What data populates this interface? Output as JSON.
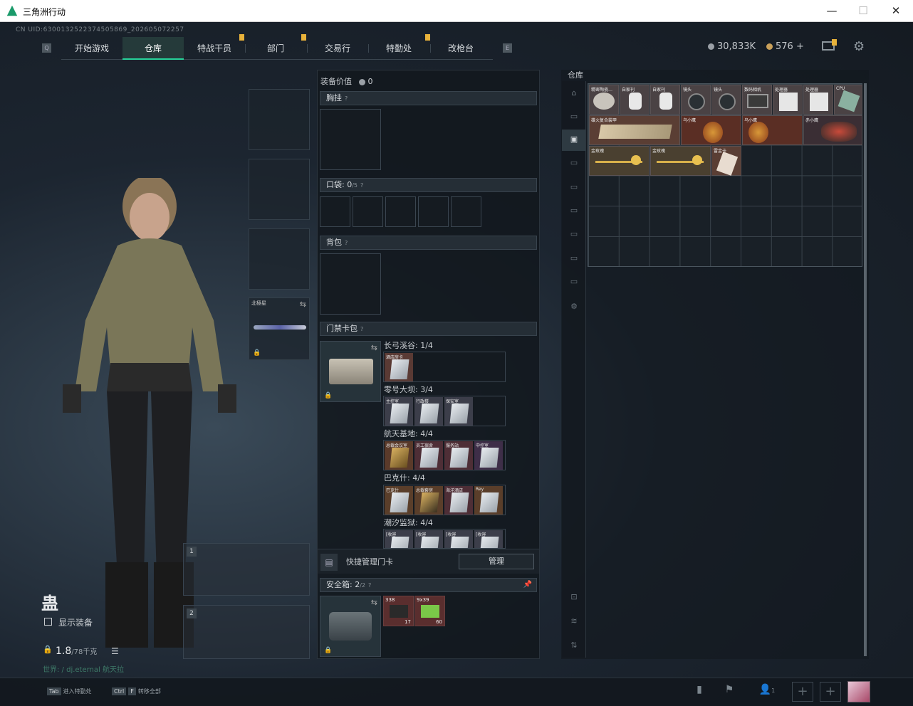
{
  "window": {
    "title": "三角洲行动",
    "min": "—",
    "max": "☐",
    "close": "✕"
  },
  "uid": "CN UID:6300132522374505869_202605072257",
  "nav": {
    "tabs": [
      {
        "label": "开始游戏",
        "active": false
      },
      {
        "label": "仓库",
        "active": true
      },
      {
        "label": "特战干员",
        "active": false
      },
      {
        "label": "部门",
        "active": false
      },
      {
        "label": "交易行",
        "active": false
      },
      {
        "label": "特勤处",
        "active": false
      },
      {
        "label": "改枪台",
        "active": false
      }
    ],
    "left_key": "Q",
    "right_key": "E"
  },
  "currency": {
    "silver": "30,833K",
    "gold": "576",
    "add": "+"
  },
  "colors": {
    "accent": "#27d39a",
    "notify": "#e8b23a"
  },
  "loadout": {
    "value_label": "装备价值",
    "value": "0",
    "chest": {
      "label": "胸挂",
      "help": "?"
    },
    "pocket": {
      "label": "口袋:",
      "count": "0",
      "cap": "/5",
      "help": "?"
    },
    "backpack": {
      "label": "背包",
      "help": "?"
    },
    "keycard": {
      "label": "门禁卡包",
      "help": "?"
    },
    "melee_name": "北極星",
    "manage_label": "快捷管理门卡",
    "manage_btn": "管理",
    "safe": {
      "label": "安全箱:",
      "count": "2",
      "cap": "/2",
      "help": "?",
      "item1_top": "338",
      "item1_count": "17",
      "item2_top": "9x39",
      "item2_count": "60"
    }
  },
  "key_maps": [
    {
      "name": "长弓溪谷:",
      "value": "1/4",
      "cards": [
        "酒店房卡"
      ]
    },
    {
      "name": "零号大坝:",
      "value": "3/4",
      "cards": [
        "主控室",
        "行政楼",
        "保安室"
      ]
    },
    {
      "name": "航天基地:",
      "value": "4/4",
      "cards": [
        "总裁会议室",
        "员工宿舍",
        "服务站",
        "中控室"
      ]
    },
    {
      "name": "巴克什:",
      "value": "4/4",
      "cards": [
        "巴克什",
        "总裁套房",
        "海洋酒店",
        "Rey"
      ]
    },
    {
      "name": "潮汐监狱:",
      "value": "4/4",
      "cards": [
        "[收容",
        "[收容",
        "[收容",
        "[收容"
      ]
    }
  ],
  "warehouse": {
    "label": "仓库",
    "items": [
      {
        "label": "精密陶瓷…"
      },
      {
        "label": "自家刊"
      },
      {
        "label": "自家刊"
      },
      {
        "label": "镜头"
      },
      {
        "label": "镜头"
      },
      {
        "label": "数码相机"
      },
      {
        "label": "处理器"
      },
      {
        "label": "处理器"
      },
      {
        "label": "CPU"
      },
      {
        "label": "雄火复合装甲"
      },
      {
        "label": "乌小鹰"
      },
      {
        "label": "乌小鹰"
      },
      {
        "label": "赤小鹰"
      },
      {
        "label": "金玫瑰"
      },
      {
        "label": "金玫瑰"
      },
      {
        "label": "雷金卡"
      }
    ]
  },
  "character": {
    "name": "蛊",
    "show_gear": "显示装备",
    "weight": "1.8",
    "weight_max": "/78千克",
    "world_text": "世界: / dj.eternal 航天拉",
    "weapon_slots": [
      "1",
      "2"
    ]
  },
  "bottom": {
    "tab_key": "Tab",
    "tab_label": "进入特勤处",
    "ctrl_key": "Ctrl",
    "f_key": "F",
    "transfer_label": "转移全部",
    "squad_count": "1"
  }
}
